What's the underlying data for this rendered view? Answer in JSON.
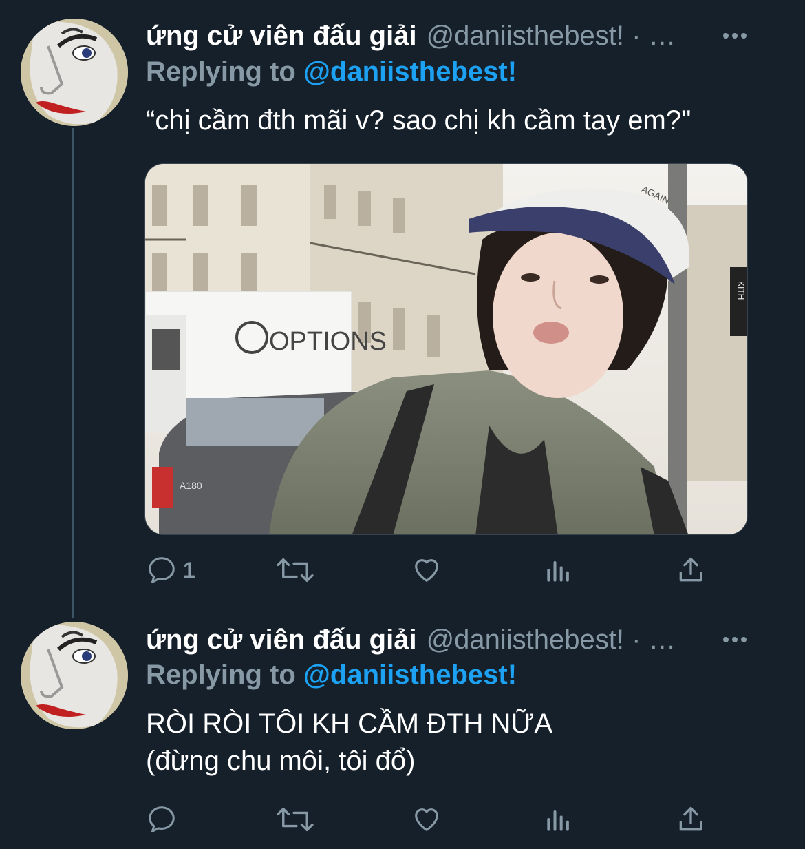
{
  "tweets": [
    {
      "name": "ứng cử viên đấu giải",
      "handle": "@daniisthebest! · …",
      "replying_prefix": "Replying to ",
      "replying_mention": "@daniisthebest!",
      "text_lines": [
        "“chị cầm đth mãi v? sao chị kh cầm tay em?\""
      ],
      "has_media": true,
      "media_text": {
        "truck": "OPTIONS",
        "cap": "AGAIN",
        "sign": "KITH",
        "plate": "A180"
      },
      "actions": {
        "reply_count": "1"
      }
    },
    {
      "name": "ứng cử viên đấu giải",
      "handle": "@daniisthebest! · …",
      "replying_prefix": "Replying to ",
      "replying_mention": "@daniisthebest!",
      "text_lines": [
        "RÒI RÒI TÔI KH CẦM ĐTH NỮA",
        "(đừng chu môi, tôi đổ)"
      ],
      "has_media": false,
      "actions": {
        "reply_count": ""
      }
    }
  ],
  "colors": {
    "background": "#15202b",
    "text": "#ffffff",
    "secondary": "#8899a6",
    "mention": "#1da1f2",
    "thread_line": "#3d5466"
  },
  "icons": [
    "reply-icon",
    "retweet-icon",
    "like-icon",
    "analytics-icon",
    "share-icon",
    "more-icon"
  ]
}
